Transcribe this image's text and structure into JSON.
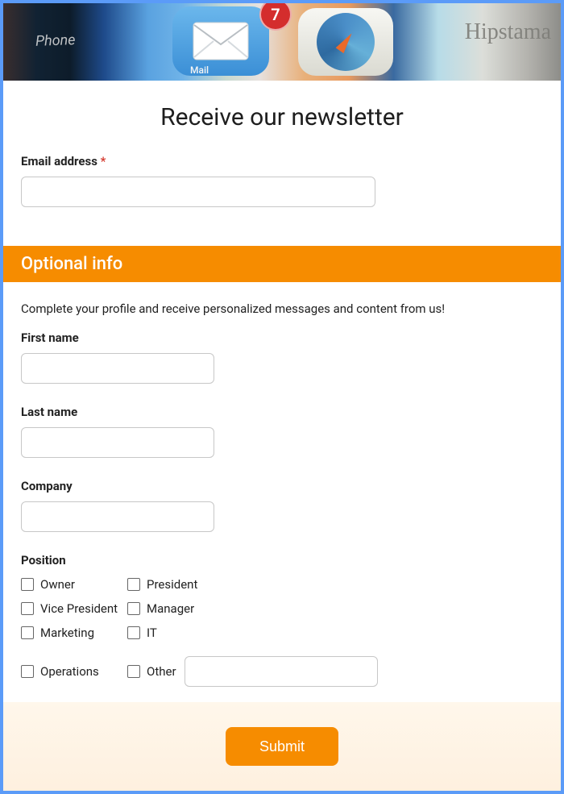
{
  "hero": {
    "badge_count": "7",
    "phone_text": "Phone",
    "mail_text": "Mail",
    "hipsta_text": "Hipstama"
  },
  "title": "Receive our newsletter",
  "email": {
    "label": "Email address",
    "required_mark": "*",
    "value": ""
  },
  "band_title": "Optional info",
  "subtext": "Complete your profile and receive personalized messages and content from us!",
  "first_name": {
    "label": "First name",
    "value": ""
  },
  "last_name": {
    "label": "Last name",
    "value": ""
  },
  "company": {
    "label": "Company",
    "value": ""
  },
  "position": {
    "label": "Position",
    "options": {
      "owner": "Owner",
      "president": "President",
      "vice_president": "Vice President",
      "manager": "Manager",
      "marketing": "Marketing",
      "it": "IT",
      "operations": "Operations",
      "other": "Other"
    },
    "other_value": ""
  },
  "submit_label": "Submit"
}
